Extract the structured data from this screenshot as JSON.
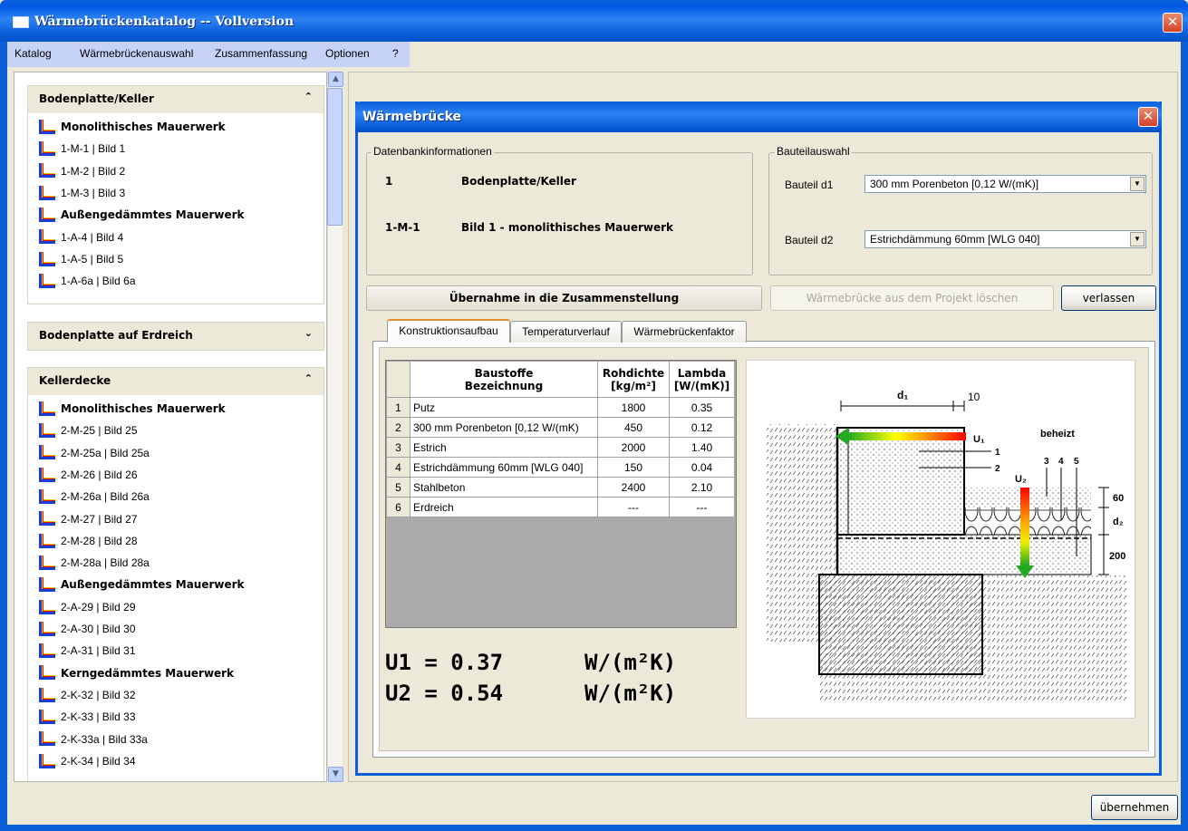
{
  "window": {
    "title": "Wärmebrückenkatalog  --  Vollversion",
    "close": "✕"
  },
  "menu": [
    "Katalog",
    "Wärmebrückenauswahl",
    "Zusammenfassung",
    "Optionen",
    "?"
  ],
  "groups": [
    {
      "title": "Bodenplatte/Keller",
      "chev": "⌃",
      "items": [
        {
          "t": "Monolithisches Mauerwerk",
          "b": true
        },
        {
          "t": "1-M-1  |  Bild 1"
        },
        {
          "t": "1-M-2  |  Bild 2"
        },
        {
          "t": "1-M-3  |  Bild 3"
        },
        {
          "t": "Außengedämmtes Mauerwerk",
          "b": true
        },
        {
          "t": "1-A-4  |  Bild 4"
        },
        {
          "t": "1-A-5  |  Bild 5"
        },
        {
          "t": "1-A-6a  |  Bild 6a"
        }
      ]
    },
    {
      "title": "Bodenplatte auf Erdreich",
      "chev": "⌄",
      "items": []
    },
    {
      "title": "Kellerdecke",
      "chev": "⌃",
      "items": [
        {
          "t": "Monolithisches Mauerwerk",
          "b": true
        },
        {
          "t": "2-M-25  |  Bild 25"
        },
        {
          "t": "2-M-25a  |  Bild 25a"
        },
        {
          "t": "2-M-26  |  Bild 26"
        },
        {
          "t": "2-M-26a  |  Bild 26a"
        },
        {
          "t": "2-M-27  |  Bild 27"
        },
        {
          "t": "2-M-28  |  Bild 28"
        },
        {
          "t": "2-M-28a  |  Bild 28a"
        },
        {
          "t": "Außengedämmtes Mauerwerk",
          "b": true
        },
        {
          "t": "2-A-29  |  Bild 29"
        },
        {
          "t": "2-A-30  |  Bild 30"
        },
        {
          "t": "2-A-31  |  Bild 31"
        },
        {
          "t": "Kerngedämmtes Mauerwerk",
          "b": true
        },
        {
          "t": "2-K-32  |  Bild 32"
        },
        {
          "t": "2-K-33  |  Bild 33"
        },
        {
          "t": "2-K-33a  |  Bild 33a"
        },
        {
          "t": "2-K-34  |  Bild 34"
        }
      ]
    }
  ],
  "dialog": {
    "title": "Wärmebrücke",
    "db_legend": "Datenbankinformationen",
    "db_row1_num": "1",
    "db_row1_text": "Bodenplatte/Keller",
    "db_row2_num": "1-M-1",
    "db_row2_text": "Bild 1 - monolithisches Mauerwerk",
    "bauteil_legend": "Bauteilauswahl",
    "d1_label": "Bauteil  d1",
    "d1_value": "300 mm Porenbeton [0,12 W/(mK)]",
    "d2_label": "Bauteil  d2",
    "d2_value": "Estrichdämmung 60mm [WLG 040]",
    "btn_uebernahme": "Übernahme in die Zusammenstellung",
    "btn_loeschen": "Wärmebrücke aus dem Projekt löschen",
    "btn_verlassen": "verlassen",
    "tabs": [
      "Konstruktionsaufbau",
      "Temperaturverlauf",
      "Wärmebrückenfaktor"
    ],
    "table": {
      "headers": [
        "Baustoffe\nBezeichnung",
        "Rohdichte\n[kg/m²]",
        "Lambda\n[W/(mK)]"
      ],
      "rows": [
        [
          "1",
          "Putz",
          "1800",
          "0.35"
        ],
        [
          "2",
          "300 mm Porenbeton [0,12 W/(mK)",
          "450",
          "0.12"
        ],
        [
          "3",
          "Estrich",
          "2000",
          "1.40"
        ],
        [
          "4",
          "Estrichdämmung 60mm [WLG 040]",
          "150",
          "0.04"
        ],
        [
          "5",
          "Stahlbeton",
          "2400",
          "2.10"
        ],
        [
          "6",
          "Erdreich",
          "---",
          "---"
        ]
      ]
    },
    "u1": "U1 = 0.37",
    "u2": "U2 = 0.54",
    "unit": "W/(m²K)",
    "drawing": {
      "d1": "d₁",
      "ten": "10",
      "u1": "U₁",
      "u2": "U₂",
      "beheizt": "beheizt",
      "n1": "1",
      "n2": "2",
      "n3": "3",
      "n4": "4",
      "n5": "5",
      "sixty": "60",
      "d2": "d₂",
      "twohundred": "200"
    }
  },
  "ok_button": "übernehmen"
}
